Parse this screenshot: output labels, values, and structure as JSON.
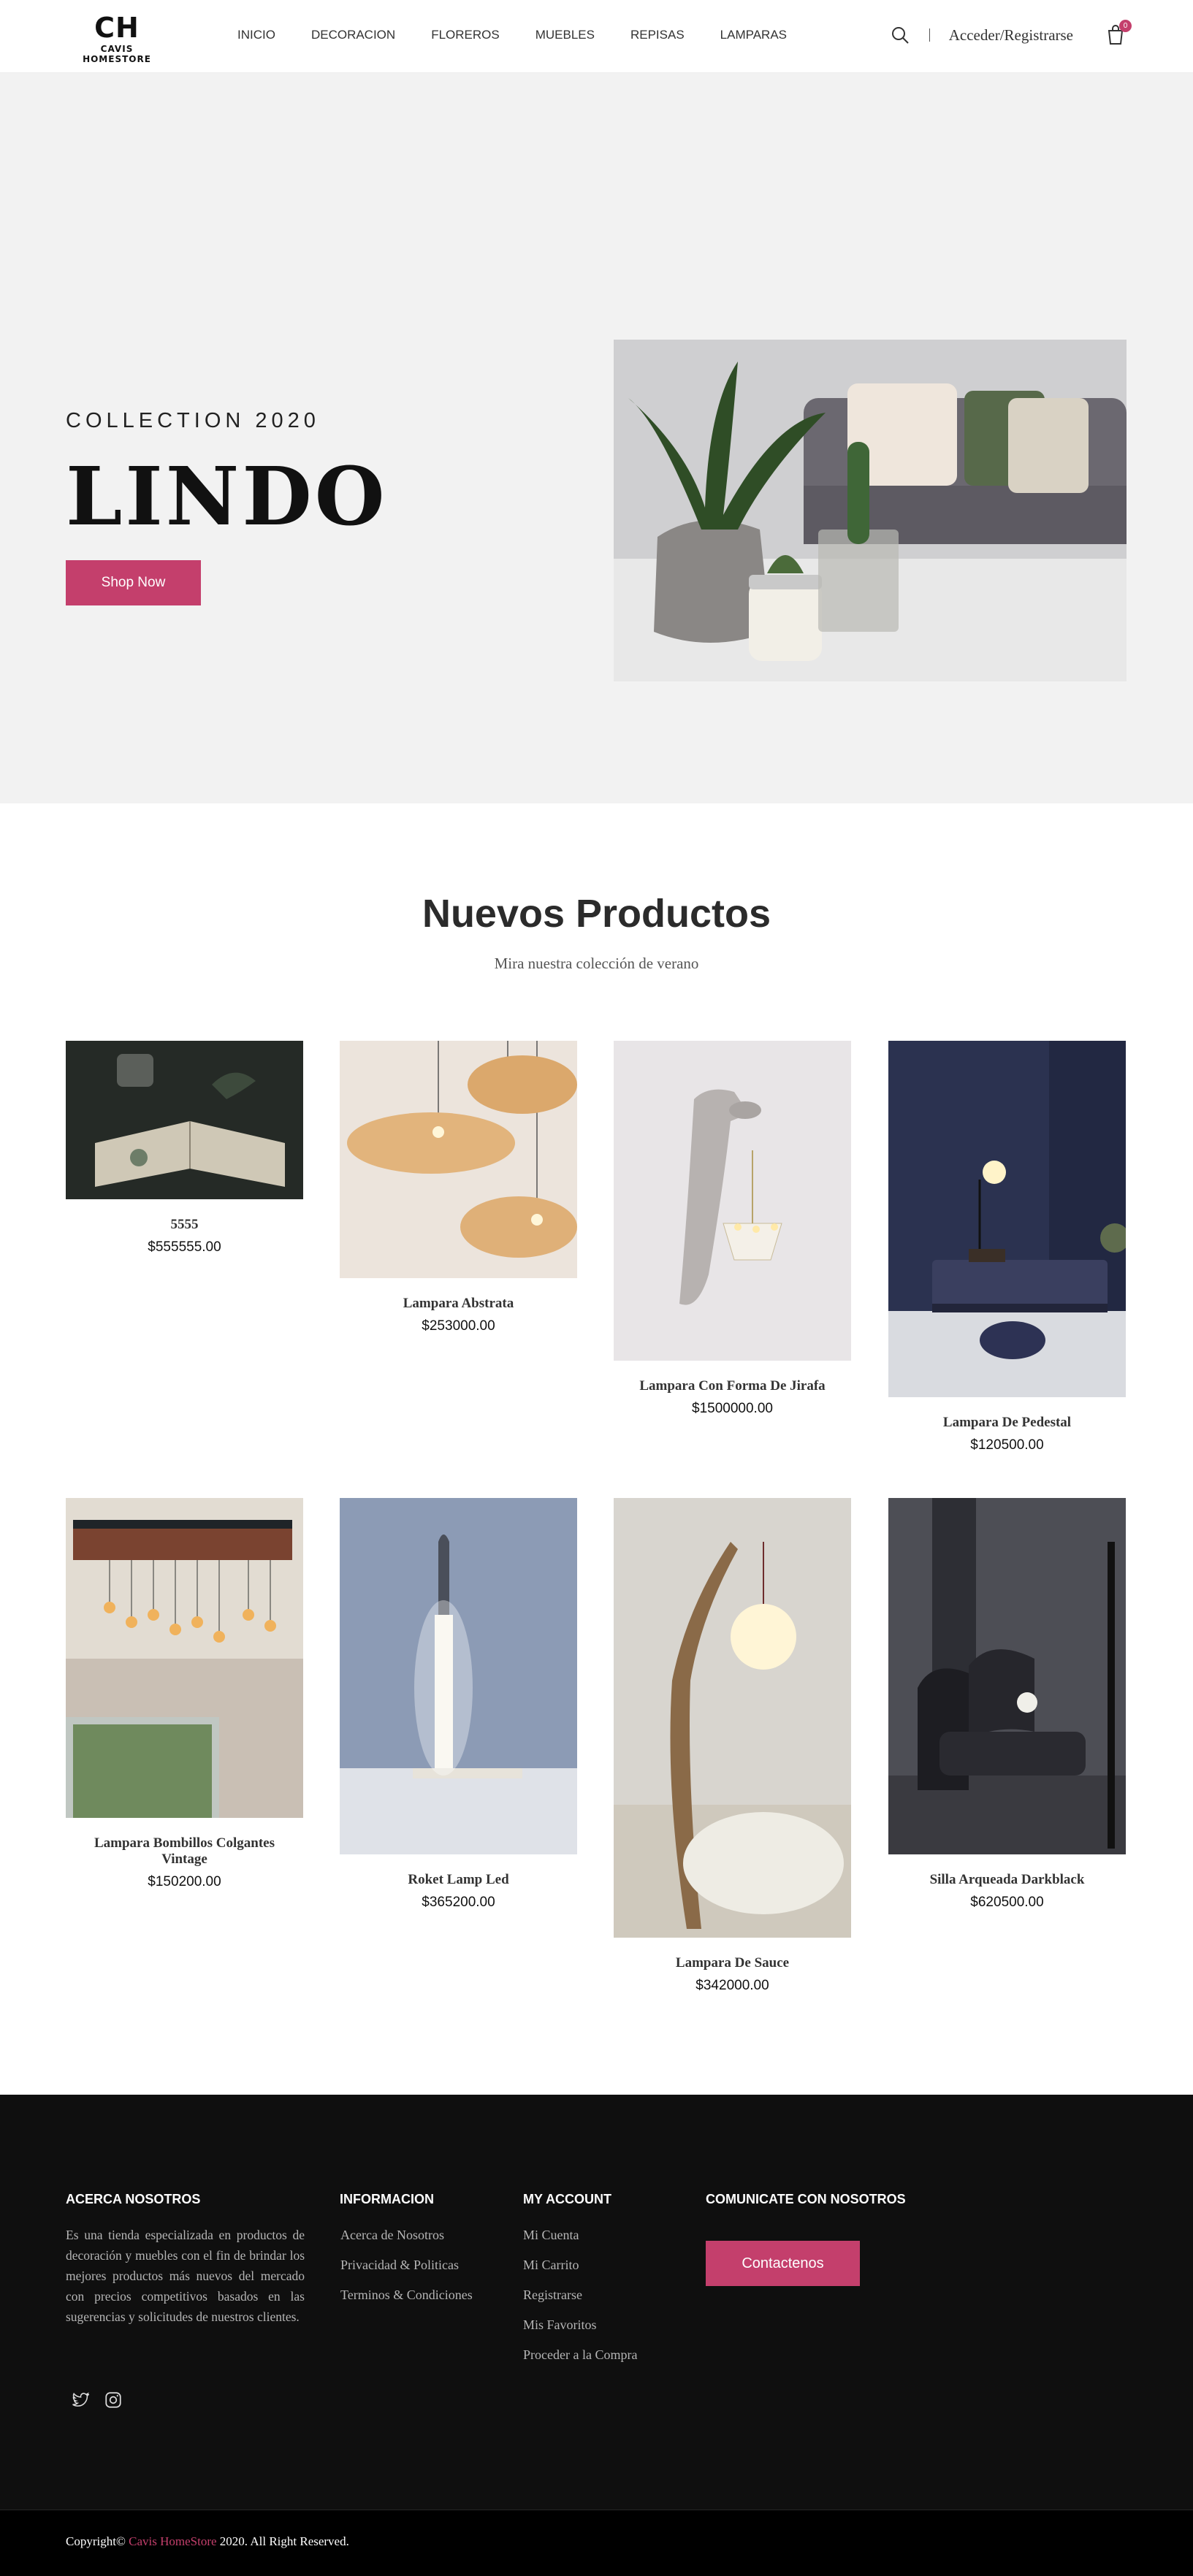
{
  "header": {
    "logo_mark": "CH",
    "logo_text": "CAVIS HOMESTORE",
    "nav": [
      "INICIO",
      "DECORACION",
      "FLOREROS",
      "MUEBLES",
      "REPISAS",
      "LAMPARAS"
    ],
    "login_label": "Acceder/Registrarse",
    "cart_count": "0"
  },
  "hero": {
    "eyebrow": "COLLECTION 2020",
    "title": "LINDO",
    "button_label": "Shop Now"
  },
  "products": {
    "title": "Nuevos Productos",
    "subtitle": "Mira nuestra colección de verano",
    "items": [
      {
        "name": "5555",
        "price": "$555555.00"
      },
      {
        "name": "Lampara Abstrata",
        "price": "$253000.00"
      },
      {
        "name": "Lampara Con Forma De Jirafa",
        "price": "$1500000.00"
      },
      {
        "name": "Lampara De Pedestal",
        "price": "$120500.00"
      },
      {
        "name": "Lampara Bombillos Colgantes Vintage",
        "price": "$150200.00"
      },
      {
        "name": "Roket Lamp Led",
        "price": "$365200.00"
      },
      {
        "name": "Lampara De Sauce",
        "price": "$342000.00"
      },
      {
        "name": "Silla Arqueada Darkblack",
        "price": "$620500.00"
      }
    ]
  },
  "footer": {
    "about_title": "ACERCA NOSOTROS",
    "about_text": "Es una tienda especializada en productos de decoración y muebles con el fin de brindar los mejores productos más nuevos del mercado con precios competitivos basados en las sugerencias y solicitudes de nuestros clientes.",
    "info_title": "INFORMACION",
    "info_links": [
      "Acerca de Nosotros",
      "Privacidad & Politicas",
      "Terminos & Condiciones"
    ],
    "account_title": "MY ACCOUNT",
    "account_links": [
      "Mi Cuenta",
      "Mi Carrito",
      "Registrarse",
      "Mis Favoritos",
      "Proceder a la Compra"
    ],
    "contact_title": "COMUNICATE CON NOSOTROS",
    "contact_button": "Contactenos",
    "social_icons": [
      "twitter-icon",
      "instagram-icon"
    ],
    "copyright_prefix": "Copyright©",
    "copyright_brand": "Cavis HomeStore",
    "copyright_suffix": "2020. All Right Reserved."
  },
  "colors": {
    "accent": "#c43f6c",
    "hero_bg": "#f2f2f2",
    "footer_bg": "#0f0f0f"
  }
}
